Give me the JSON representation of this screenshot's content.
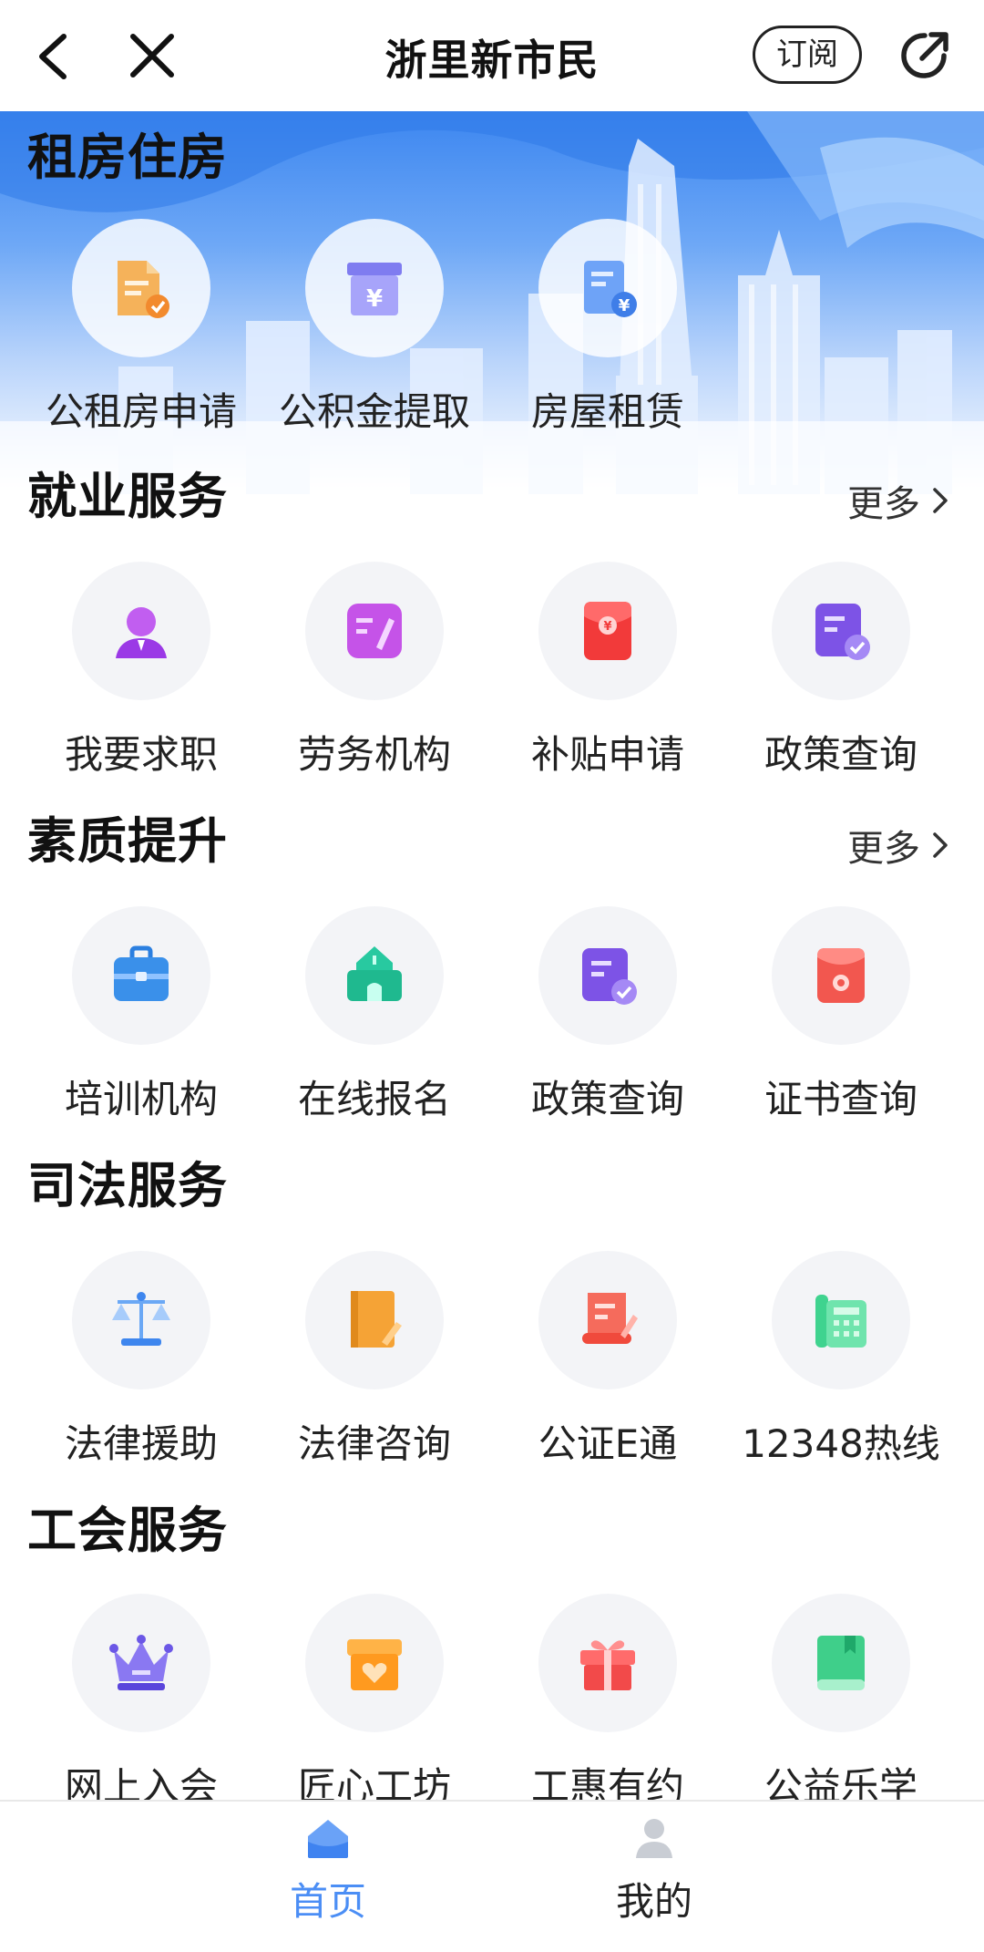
{
  "topbar": {
    "title": "浙里新市民",
    "subscribe_label": "订阅"
  },
  "sections": [
    {
      "title": "租房住房",
      "items": [
        {
          "label": "公租房申请",
          "icon": "document-check-icon"
        },
        {
          "label": "公积金提取",
          "icon": "yuan-box-icon"
        },
        {
          "label": "房屋租赁",
          "icon": "contract-yuan-icon"
        }
      ]
    },
    {
      "title": "就业服务",
      "more": "更多",
      "items": [
        {
          "label": "我要求职",
          "icon": "person-icon"
        },
        {
          "label": "劳务机构",
          "icon": "pen-note-icon"
        },
        {
          "label": "补贴申请",
          "icon": "red-envelope-icon"
        },
        {
          "label": "政策查询",
          "icon": "policy-check-icon"
        }
      ]
    },
    {
      "title": "素质提升",
      "more": "更多",
      "items": [
        {
          "label": "培训机构",
          "icon": "briefcase-icon"
        },
        {
          "label": "在线报名",
          "icon": "school-icon"
        },
        {
          "label": "政策查询",
          "icon": "policy-check-icon"
        },
        {
          "label": "证书查询",
          "icon": "certificate-icon"
        }
      ]
    },
    {
      "title": "司法服务",
      "items": [
        {
          "label": "法律援助",
          "icon": "scales-icon"
        },
        {
          "label": "法律咨询",
          "icon": "law-book-icon"
        },
        {
          "label": "公证E通",
          "icon": "notary-scroll-icon"
        },
        {
          "label": "12348热线",
          "icon": "telephone-icon"
        }
      ]
    },
    {
      "title": "工会服务",
      "items": [
        {
          "label": "网上入会",
          "icon": "crown-icon"
        },
        {
          "label": "匠心工坊",
          "icon": "heart-box-icon"
        },
        {
          "label": "工惠有约",
          "icon": "gift-icon"
        },
        {
          "label": "公益乐学",
          "icon": "book-icon"
        }
      ]
    }
  ],
  "tabbar": {
    "home_label": "首页",
    "mine_label": "我的",
    "active": "home"
  },
  "colors": {
    "accent_blue": "#4b8ef5",
    "banner_top": "#3c86f0",
    "tile_bg": "#f3f4f7"
  }
}
